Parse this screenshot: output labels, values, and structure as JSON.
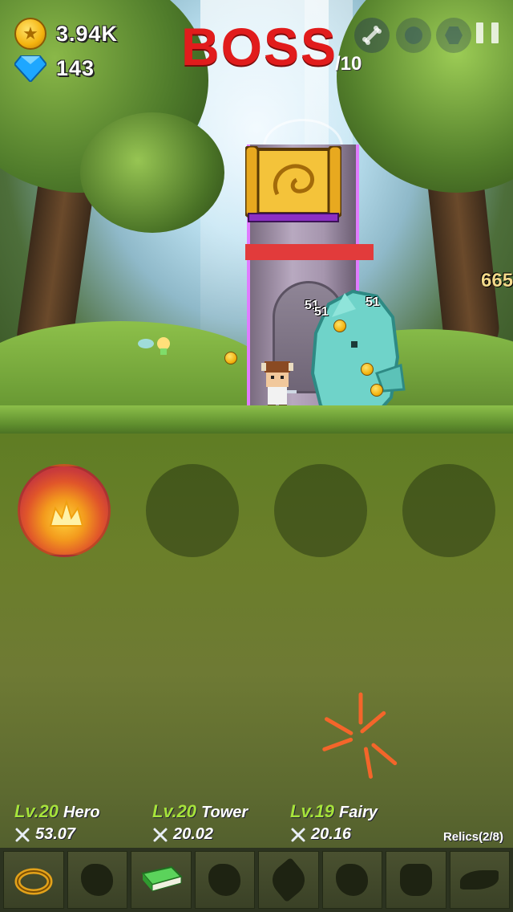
{
  "hud": {
    "gold": "3.94K",
    "gems": "143",
    "gold_icon": "coin-icon",
    "gem_icon": "diamond-icon"
  },
  "boss": {
    "title": "BOSS",
    "total": "/10",
    "hp_fraction": 1.0
  },
  "damage_numbers": [
    "51",
    "51",
    "51"
  ],
  "partial_damage": "665",
  "top_buttons": [
    {
      "icon": "bone-icon"
    },
    {
      "icon": "round-icon"
    },
    {
      "icon": "hexagon-icon"
    },
    {
      "icon": "pause-icon"
    }
  ],
  "skills": [
    {
      "name": "fire-skill",
      "icon": "flame-icon",
      "active": true
    },
    {
      "name": "empty-skill",
      "active": false
    },
    {
      "name": "empty-skill",
      "active": false
    },
    {
      "name": "empty-skill",
      "active": false
    }
  ],
  "stats": [
    {
      "level": "Lv.20",
      "name": "Hero",
      "power": "53.07"
    },
    {
      "level": "Lv.20",
      "name": "Tower",
      "power": "20.02"
    },
    {
      "level": "Lv.19",
      "name": "Fairy",
      "power": "20.16"
    }
  ],
  "relics_label": "Relics(2/8)",
  "relics": [
    {
      "icon": "ring-icon",
      "unlocked": true
    },
    {
      "icon": "helmet-icon",
      "unlocked": false
    },
    {
      "icon": "book-icon",
      "unlocked": true
    },
    {
      "icon": "leaf-icon",
      "unlocked": false
    },
    {
      "icon": "feather-icon",
      "unlocked": false
    },
    {
      "icon": "stone-icon",
      "unlocked": false
    },
    {
      "icon": "crown-icon",
      "unlocked": false
    },
    {
      "icon": "wing-icon",
      "unlocked": false
    }
  ],
  "colors": {
    "boss_title": "#e11c1c",
    "level_text": "#a6e33b",
    "boss_hp": "#e23b3b",
    "tower_glow": "#e07cff"
  }
}
